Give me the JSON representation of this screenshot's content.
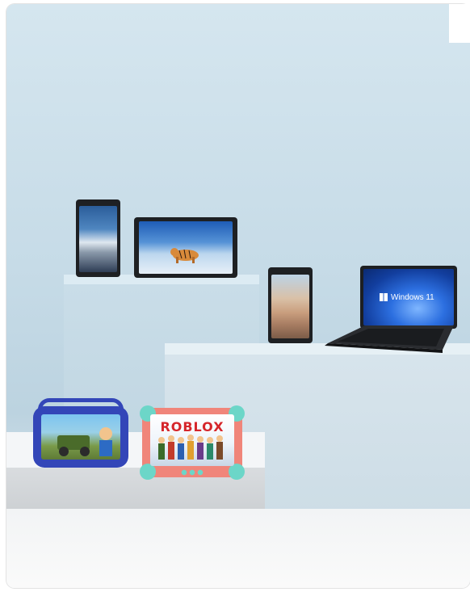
{
  "kids_tablet_right": {
    "screen_text": "ROBLOX"
  },
  "laptop": {
    "screen_text": "Windows 11"
  },
  "colors": {
    "background_wall": "#c8dce8",
    "kids_case_blue": "#3346b8",
    "kids_case_coral": "#f0857a",
    "kids_case_mint": "#6cd6c8",
    "windows_blue": "#1e5fd6"
  }
}
